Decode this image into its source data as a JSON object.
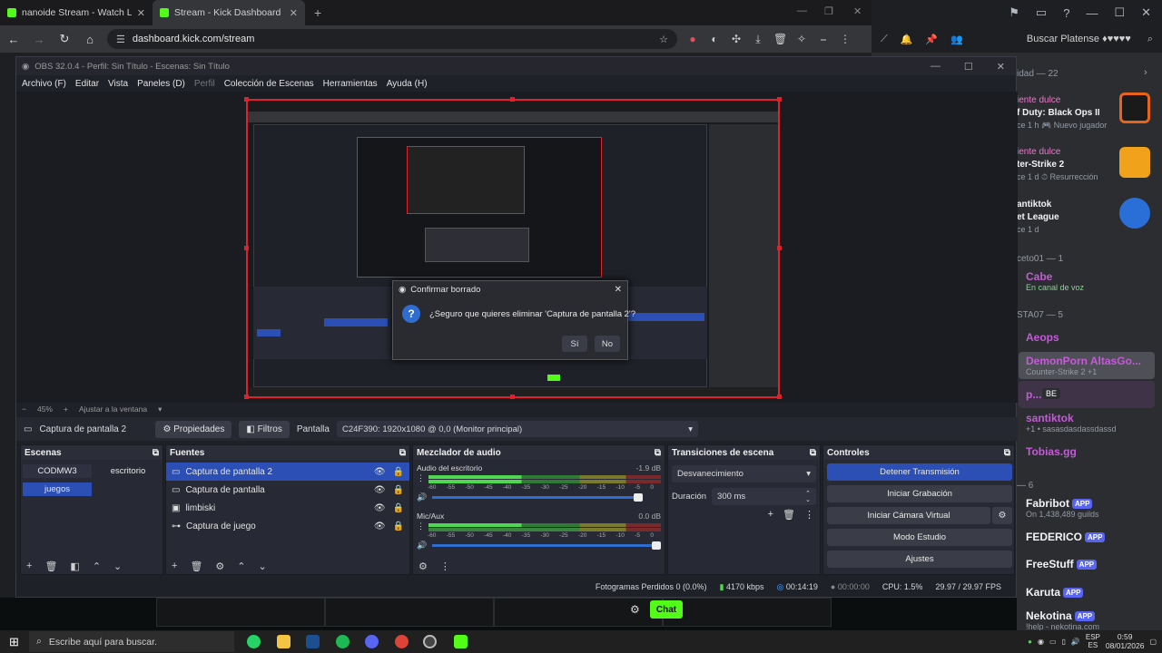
{
  "browser": {
    "tabs": [
      {
        "title": "nanoide Stream - Watch Live o"
      },
      {
        "title": "Stream - Kick Dashboard"
      }
    ],
    "url": "dashboard.kick.com/stream",
    "search_placeholder": "Buscar Platense ♦♥♥♥♥"
  },
  "discord": {
    "comunidad_header": "idad — 22",
    "activity": [
      {
        "user": "iente dulce",
        "game": "f Duty: Black Ops II",
        "sub": "ce 1 h  🎮 Nuevo jugador"
      },
      {
        "user": "iente dulce",
        "game": "ter-Strike 2",
        "sub": "ce 1 d  ⏱ Resurrección"
      },
      {
        "user": "antiktok",
        "game": "et League",
        "sub": "ce 1 d"
      }
    ],
    "group1_header": "ceto01 — 1",
    "cabe": "Cabe",
    "cabe_sub": "En canal de voz",
    "group2_header": "STA07 — 5",
    "members": [
      "Aeops",
      "DemonPorn AltasGo...",
      "p...",
      "santiktok",
      "Tobias.gg"
    ],
    "demon_sub": "Counter-Strike 2 +1",
    "santik_sub": "+1 • sasasdasdassdassd",
    "p_badge": "BE",
    "group3_header": "— 6",
    "bots": [
      {
        "name": "Fabribot",
        "sub": "On 1,438,489 guilds"
      },
      {
        "name": "FEDERICO",
        "sub": ""
      },
      {
        "name": "FreeStuff",
        "sub": ""
      },
      {
        "name": "Karuta",
        "sub": ""
      },
      {
        "name": "Nekotina",
        "sub": "!help - nekotina.com"
      }
    ],
    "app_badge": "APP"
  },
  "obs": {
    "title": "OBS 32.0.4 - Perfil: Sin Título - Escenas: Sin Título",
    "menu": [
      "Archivo (F)",
      "Editar",
      "Vista",
      "Paneles (D)",
      "Perfil",
      "Colección de Escenas",
      "Herramientas",
      "Ayuda (H)"
    ],
    "zoom": "45%",
    "fit": "Ajustar a la ventana",
    "selected_source": "Captura de pantalla 2",
    "btn_props": "Propiedades",
    "btn_filters": "Filtros",
    "pantalla_label": "Pantalla",
    "pantalla_value": "C24F390: 1920x1080 @ 0,0 (Monitor principal)",
    "docks": {
      "escenas": "Escenas",
      "fuentes": "Fuentes",
      "mezclador": "Mezclador de audio",
      "transiciones": "Transiciones de escena",
      "controles": "Controles"
    },
    "scenes": [
      "CODMW3",
      "escritorio",
      "juegos"
    ],
    "sources": [
      "Captura de pantalla 2",
      "Captura de pantalla",
      "limbiski",
      "Captura de juego"
    ],
    "audio": [
      {
        "name": "Audio del escritorio",
        "db": "-1.9 dB"
      },
      {
        "name": "Mic/Aux",
        "db": "0.0 dB"
      }
    ],
    "ticks": [
      "-60",
      "-55",
      "-50",
      "-45",
      "-40",
      "-35",
      "-30",
      "-25",
      "-20",
      "-15",
      "-10",
      "-5",
      "0"
    ],
    "transition": "Desvanecimiento",
    "duration_label": "Duración",
    "duration": "300 ms",
    "controls": [
      "Detener Transmisión",
      "Iniciar Grabación",
      "Iniciar Cámara Virtual",
      "Modo Estudio",
      "Ajustes"
    ],
    "status": {
      "dropped": "Fotogramas Perdidos 0 (0.0%)",
      "bitrate": "4170 kbps",
      "live": "00:14:19",
      "rec": "00:00:00",
      "cpu": "CPU: 1.5%",
      "fps": "29.97 / 29.97 FPS"
    },
    "dialog": {
      "title": "Confirmar borrado",
      "question": "¿Seguro que quieres eliminar 'Captura de pantalla 2'?",
      "yes": "Sí",
      "no": "No"
    }
  },
  "kick": {
    "chat": "Chat"
  },
  "taskbar": {
    "search": "Escribe aquí para buscar.",
    "lang": "ESP",
    "lang2": "ES",
    "time": "0:59",
    "date": "08/01/2026"
  },
  "colors": {
    "kick_green": "#53fc18",
    "selection_red": "#e0202a",
    "obs_blue": "#2b4fb4",
    "discord_blurple": "#5865f2"
  }
}
